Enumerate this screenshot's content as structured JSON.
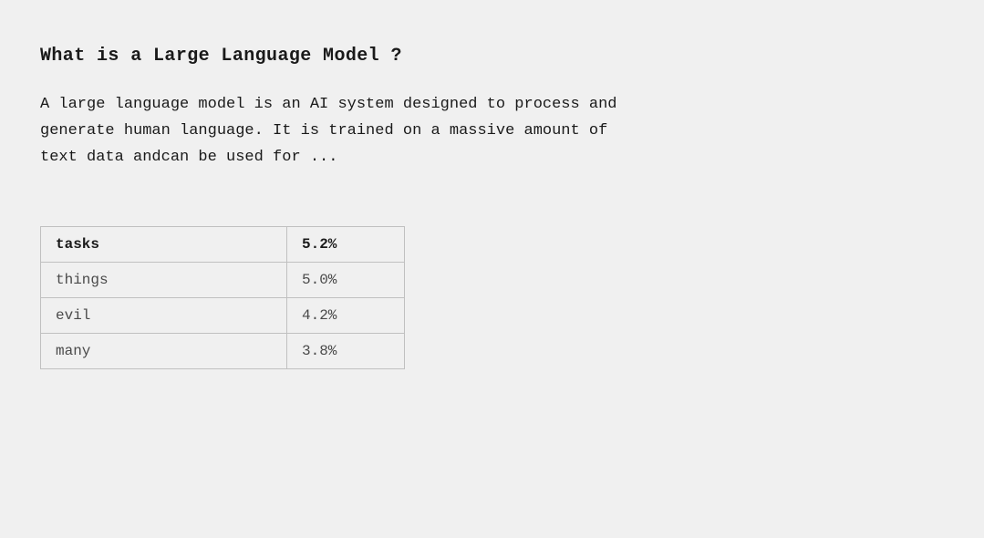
{
  "heading": "What is a Large Language Model ?",
  "description": {
    "line1": "A large language model is an AI system designed to process and",
    "line2": "generate human language.  It is trained on a massive amount of",
    "line3": "text data andcan  be used for ..."
  },
  "table": {
    "rows": [
      {
        "label": "tasks",
        "value": "5.2%"
      },
      {
        "label": "things",
        "value": "5.0%"
      },
      {
        "label": "evil",
        "value": "4.2%"
      },
      {
        "label": "many",
        "value": "3.8%"
      }
    ]
  }
}
